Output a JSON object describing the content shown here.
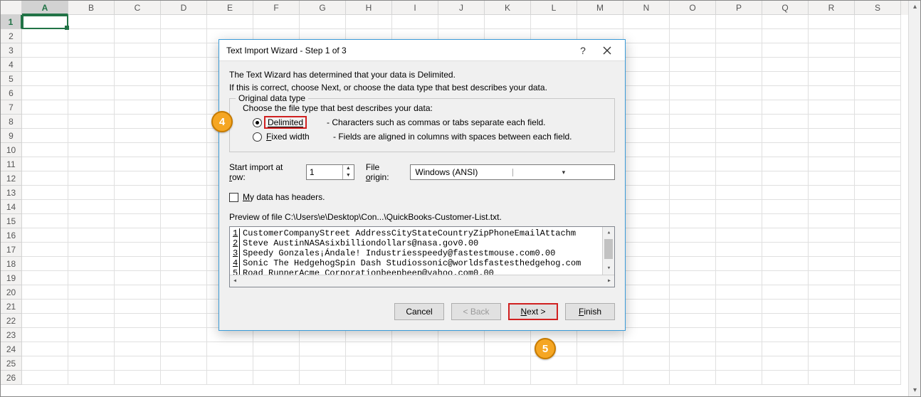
{
  "sheet": {
    "columns": [
      "A",
      "B",
      "C",
      "D",
      "E",
      "F",
      "G",
      "H",
      "I",
      "J",
      "K",
      "L",
      "M",
      "N",
      "O",
      "P",
      "Q",
      "R",
      "S"
    ],
    "rows": [
      "1",
      "2",
      "3",
      "4",
      "5",
      "6",
      "7",
      "8",
      "9",
      "10",
      "11",
      "12",
      "13",
      "14",
      "15",
      "16",
      "17",
      "18",
      "19",
      "20",
      "21",
      "22",
      "23",
      "24",
      "25",
      "26"
    ],
    "selected_col": "A",
    "selected_row": "1"
  },
  "dialog": {
    "title": "Text Import Wizard - Step 1 of 3",
    "intro1": "The Text Wizard has determined that your data is Delimited.",
    "intro2": "If this is correct, choose Next, or choose the data type that best describes your data.",
    "group_label": "Original data type",
    "group_prompt": "Choose the file type that best describes your data:",
    "radio_delimited": "Delimited",
    "radio_delimited_desc": "- Characters such as commas or tabs separate each field.",
    "radio_fixed": "Fixed width",
    "radio_fixed_desc": "- Fields are aligned in columns with spaces between each field.",
    "start_row_label": "Start import at row:",
    "start_row_value": "1",
    "file_origin_label": "File origin:",
    "file_origin_value": "Windows (ANSI)",
    "headers_checkbox": "My data has headers.",
    "preview_label": "Preview of file C:\\Users\\e\\Desktop\\Con...\\QuickBooks-Customer-List.txt.",
    "preview_lines": [
      {
        "n": "1",
        "t": "CustomerCompanyStreet AddressCityStateCountryZipPhoneEmailAttachm"
      },
      {
        "n": "2",
        "t": "Steve AustinNASAsixbilliondollars@nasa.gov0.00"
      },
      {
        "n": "3",
        "t": "Speedy Gonzales¡Ándale! Industriesspeedy@fastestmouse.com0.00"
      },
      {
        "n": "4",
        "t": "Sonic The HedgehogSpin Dash Studiossonic@worldsfastesthedgehog.com"
      },
      {
        "n": "5",
        "t": "Road RunnerAcme Corporationbeepbeep@yahoo.com0.00"
      }
    ],
    "btn_cancel": "Cancel",
    "btn_back": "< Back",
    "btn_next_u": "N",
    "btn_next_rest": "ext >",
    "btn_finish_u": "F",
    "btn_finish_rest": "inish"
  },
  "annotations": {
    "badge4": "4",
    "badge5": "5"
  }
}
